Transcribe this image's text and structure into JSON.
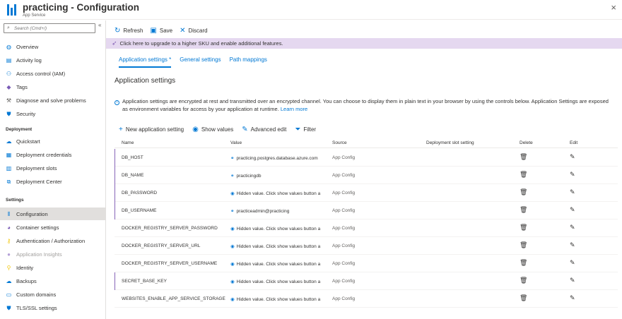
{
  "header": {
    "title": "practicing - Configuration",
    "subtitle": "App Service",
    "close": "×"
  },
  "sidebar": {
    "search_placeholder": "Search (Cmd+/)",
    "collapse": "«",
    "items_top": [
      {
        "label": "Overview",
        "icon": "globe-icon",
        "color": "#0078d4"
      },
      {
        "label": "Activity log",
        "icon": "log-icon",
        "color": "#0078d4"
      },
      {
        "label": "Access control (IAM)",
        "icon": "people-icon",
        "color": "#0078d4"
      },
      {
        "label": "Tags",
        "icon": "tag-icon",
        "color": "#7a5bb6"
      },
      {
        "label": "Diagnose and solve problems",
        "icon": "wrench-icon",
        "color": "#605e5c"
      },
      {
        "label": "Security",
        "icon": "shield-icon",
        "color": "#0078d4"
      }
    ],
    "section_deployment": "Deployment",
    "items_deployment": [
      {
        "label": "Quickstart",
        "icon": "cloud-icon",
        "color": "#0078d4"
      },
      {
        "label": "Deployment credentials",
        "icon": "credentials-icon",
        "color": "#0078d4"
      },
      {
        "label": "Deployment slots",
        "icon": "slots-icon",
        "color": "#0078d4"
      },
      {
        "label": "Deployment Center",
        "icon": "deploy-center-icon",
        "color": "#0078d4"
      }
    ],
    "section_settings": "Settings",
    "items_settings": [
      {
        "label": "Configuration",
        "icon": "config-icon",
        "color": "#0078d4"
      },
      {
        "label": "Container settings",
        "icon": "container-icon",
        "color": "#7a5bb6"
      },
      {
        "label": "Authentication / Authorization",
        "icon": "key-icon",
        "color": "#f2c811"
      },
      {
        "label": "Application Insights",
        "icon": "lightbulb-icon",
        "color": "#b4a0d8"
      },
      {
        "label": "Identity",
        "icon": "identity-icon",
        "color": "#f2c811"
      },
      {
        "label": "Backups",
        "icon": "backup-icon",
        "color": "#0078d4"
      },
      {
        "label": "Custom domains",
        "icon": "domain-icon",
        "color": "#0078d4"
      },
      {
        "label": "TLS/SSL settings",
        "icon": "tls-shield-icon",
        "color": "#0078d4"
      }
    ]
  },
  "toolbar": {
    "refresh": "Refresh",
    "save": "Save",
    "discard": "Discard"
  },
  "banner": {
    "text": "Click here to upgrade to a higher SKU and enable additional features."
  },
  "tabs": [
    {
      "label": "Application settings",
      "marker": "*"
    },
    {
      "label": "General settings"
    },
    {
      "label": "Path mappings"
    }
  ],
  "section_title": "Application settings",
  "info": {
    "text": "Application settings are encrypted at rest and transmitted over an encrypted channel. You can choose to display them in plain text in your browser by using the controls below. Application Settings are exposed as environment variables for access by your application at runtime.",
    "link": "Learn more"
  },
  "actions": {
    "new": "New application setting",
    "show": "Show values",
    "advanced": "Advanced edit",
    "filter": "Filter"
  },
  "table": {
    "headers": {
      "name": "Name",
      "value": "Value",
      "source": "Source",
      "slot": "Deployment slot setting",
      "delete": "Delete",
      "edit": "Edit"
    },
    "rows": [
      {
        "name": "DB_HOST",
        "value": "practicing.postgres.database.azure.com",
        "source": "App Config",
        "slot": true
      },
      {
        "name": "DB_NAME",
        "value": "practicingdb",
        "source": "App Config",
        "slot": true
      },
      {
        "name": "DB_PASSWORD",
        "value": "Hidden value. Click show values button a",
        "source": "App Config",
        "slot": true
      },
      {
        "name": "DB_USERNAME",
        "value": "practiceadmin@practicing",
        "source": "App Config",
        "slot": true
      },
      {
        "name": "DOCKER_REGISTRY_SERVER_PASSWORD",
        "value": "Hidden value. Click show values button a",
        "source": "App Config",
        "slot": false
      },
      {
        "name": "DOCKER_REGISTRY_SERVER_URL",
        "value": "Hidden value. Click show values button a",
        "source": "App Config",
        "slot": false
      },
      {
        "name": "DOCKER_REGISTRY_SERVER_USERNAME",
        "value": "Hidden value. Click show values button a",
        "source": "App Config",
        "slot": false
      },
      {
        "name": "SECRET_BASE_KEY",
        "value": "Hidden value. Click show values button a",
        "source": "App Config",
        "slot": true
      },
      {
        "name": "WEBSITES_ENABLE_APP_SERVICE_STORAGE",
        "value": "Hidden value. Click show values button a",
        "source": "App Config",
        "slot": false
      }
    ]
  }
}
